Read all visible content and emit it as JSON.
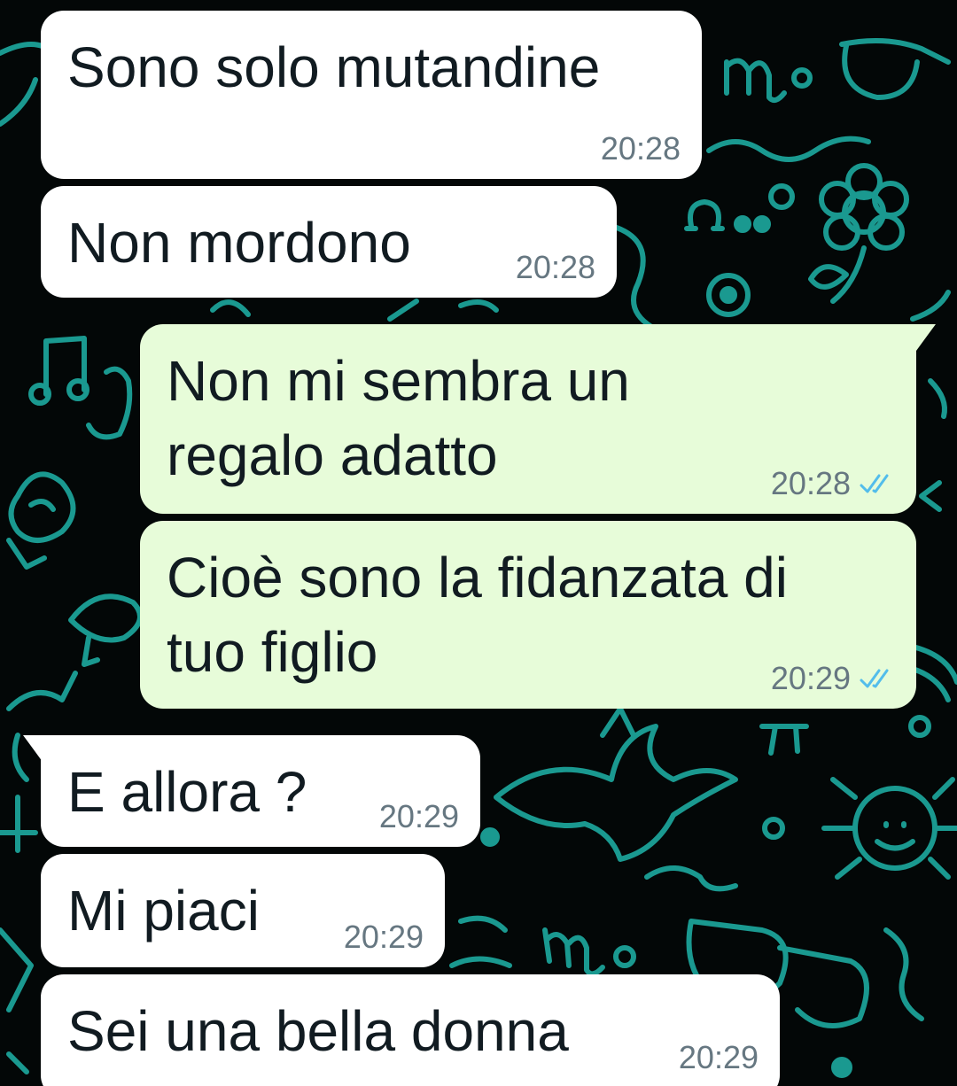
{
  "chat": {
    "messages": [
      {
        "direction": "in",
        "text": "Sono solo mutandine",
        "time": "20:28"
      },
      {
        "direction": "in",
        "text": "Non mordono",
        "time": "20:28"
      },
      {
        "direction": "out",
        "text": "Non mi sembra un\nregalo adatto",
        "time": "20:28",
        "status": "read"
      },
      {
        "direction": "out",
        "text": "Cioè sono la fidanzata di\ntuo figlio",
        "time": "20:29",
        "status": "read"
      },
      {
        "direction": "in",
        "text": "E allora ?",
        "time": "20:29"
      },
      {
        "direction": "in",
        "text": "Mi piaci",
        "time": "20:29"
      },
      {
        "direction": "in",
        "text": "Sei una bella donna",
        "time": "20:29"
      }
    ]
  },
  "colors": {
    "incoming_bubble": "#ffffff",
    "outgoing_bubble": "#e7fcd9",
    "read_ticks": "#53bdeb",
    "wallpaper_doodle": "#1fb3a8",
    "wallpaper_background": "#030707"
  }
}
